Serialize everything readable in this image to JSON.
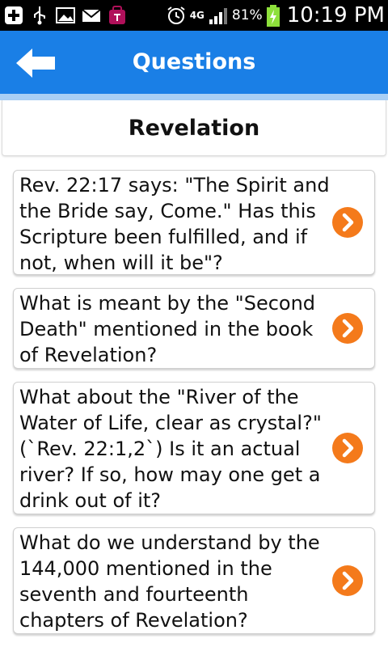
{
  "status_bar": {
    "network": "4G",
    "battery_percent": "81%",
    "time": "10:19 PM"
  },
  "app_bar": {
    "title": "Questions"
  },
  "section": {
    "title": "Revelation"
  },
  "questions": [
    {
      "text": "Rev. 22:17 says: \"The Spirit and the Bride say, Come.\" Has this Scripture been fulfilled, and if not, when will it be\"?"
    },
    {
      "text": "What is meant by the \"Second Death\" mentioned in the book of Revelation?"
    },
    {
      "text": "What about the \"River of the Water of Life, clear as crystal?\" (`Rev. 22:1,2`) Is it an actual river? If so, how may one get a drink out of it?"
    },
    {
      "text": "What do we understand by the 144,000 mentioned in the seventh and fourteenth chapters of Revelation?"
    }
  ],
  "colors": {
    "app_bar": "#1a7fe6",
    "chevron": "#f47a1b"
  }
}
